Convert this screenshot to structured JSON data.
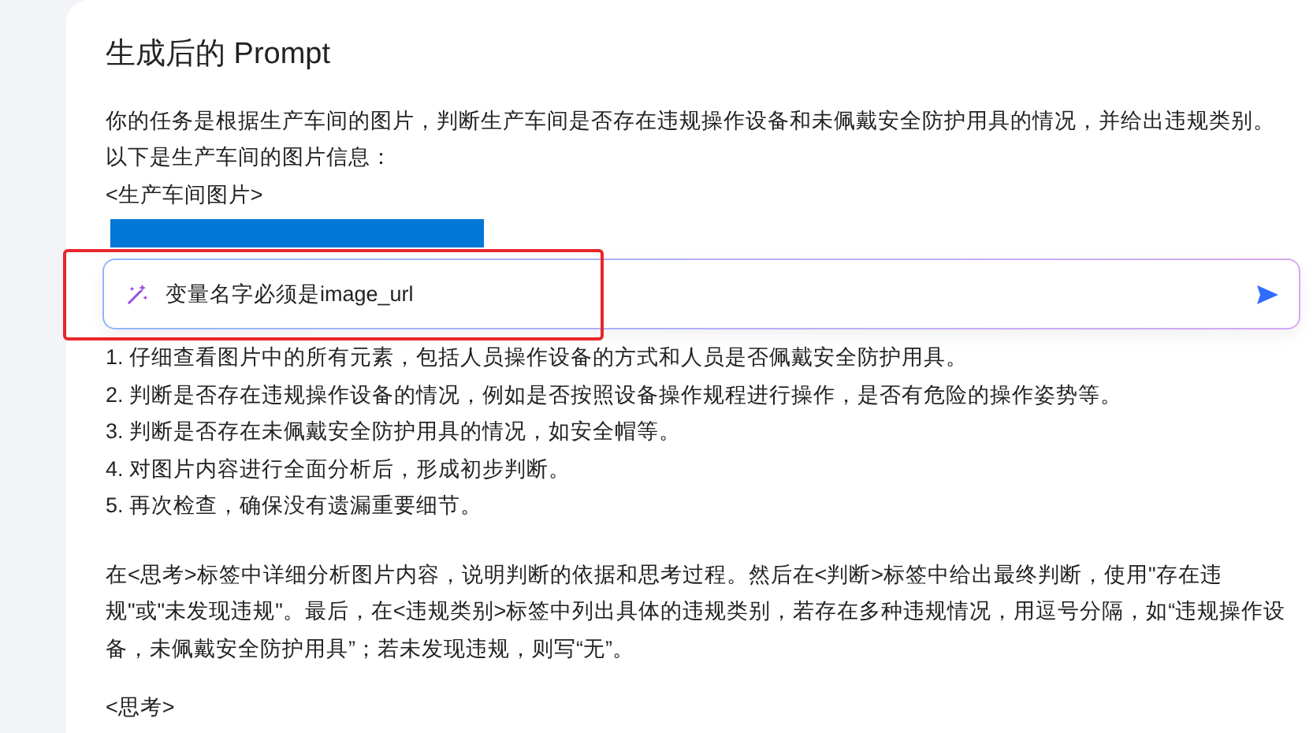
{
  "heading": "生成后的 Prompt",
  "intro_lines": [
    "你的任务是根据生产车间的图片，判断生产车间是否存在违规操作设备和未佩戴安全防护用具的情况，并给出违规类别。",
    "以下是生产车间的图片信息：",
    "<生产车间图片>"
  ],
  "prompt_input": {
    "value": "变量名字必须是image_url"
  },
  "steps": [
    "1. 仔细查看图片中的所有元素，包括人员操作设备的方式和人员是否佩戴安全防护用具。",
    "2. 判断是否存在违规操作设备的情况，例如是否按照设备操作规程进行操作，是否有危险的操作姿势等。",
    "3. 判断是否存在未佩戴安全防护用具的情况，如安全帽等。",
    "4. 对图片内容进行全面分析后，形成初步判断。",
    "5. 再次检查，确保没有遗漏重要细节。"
  ],
  "instruction": "在<思考>标签中详细分析图片内容，说明判断的依据和思考过程。然后在<判断>标签中给出最终判断，使用\"存在违规\"或\"未发现违规\"。最后，在<违规类别>标签中列出具体的违规类别，若存在多种违规情况，用逗号分隔，如“违规操作设备，未佩戴安全防护用具”；若未发现违规，则写“无”。",
  "trailing_line": "<思考>"
}
